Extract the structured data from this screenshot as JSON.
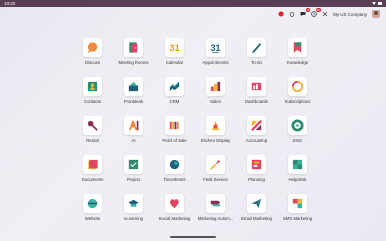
{
  "status": {
    "time": "10:32"
  },
  "topbar": {
    "msg_count": "5",
    "act_count": "99",
    "company": "My US Company"
  },
  "apps": [
    {
      "label": "Discuss",
      "icon": "discuss-icon"
    },
    {
      "label": "Meeting Rooms",
      "icon": "meeting-rooms-icon"
    },
    {
      "label": "Calendar",
      "icon": "calendar-icon",
      "glyph": "31"
    },
    {
      "label": "Appointments",
      "icon": "appointments-icon",
      "glyph": "31"
    },
    {
      "label": "To-do",
      "icon": "todo-icon"
    },
    {
      "label": "Knowledge",
      "icon": "knowledge-icon"
    },
    {
      "label": "Contacts",
      "icon": "contacts-icon"
    },
    {
      "label": "Frontdesk",
      "icon": "frontdesk-icon"
    },
    {
      "label": "CRM",
      "icon": "crm-icon"
    },
    {
      "label": "Sales",
      "icon": "sales-icon"
    },
    {
      "label": "Dashboards",
      "icon": "dashboards-icon"
    },
    {
      "label": "Subscriptions",
      "icon": "subscriptions-icon"
    },
    {
      "label": "Rental",
      "icon": "rental-icon"
    },
    {
      "label": "AI",
      "icon": "ai-icon"
    },
    {
      "label": "Point of Sale",
      "icon": "point-of-sale-icon"
    },
    {
      "label": "Kitchen Display",
      "icon": "kitchen-display-icon"
    },
    {
      "label": "Accounting",
      "icon": "accounting-icon"
    },
    {
      "label": "ESG",
      "icon": "esg-icon"
    },
    {
      "label": "Documents",
      "icon": "documents-icon"
    },
    {
      "label": "Project",
      "icon": "project-icon"
    },
    {
      "label": "Timesheets",
      "icon": "timesheets-icon"
    },
    {
      "label": "Field Service",
      "icon": "field-service-icon"
    },
    {
      "label": "Planning",
      "icon": "planning-icon"
    },
    {
      "label": "Helpdesk",
      "icon": "helpdesk-icon"
    },
    {
      "label": "Website",
      "icon": "website-icon"
    },
    {
      "label": "eLearning",
      "icon": "elearning-icon"
    },
    {
      "label": "Social Marketing",
      "icon": "social-marketing-icon"
    },
    {
      "label": "Marketing Autom...",
      "icon": "marketing-automation-icon"
    },
    {
      "label": "Email Marketing",
      "icon": "email-marketing-icon"
    },
    {
      "label": "SMS Marketing",
      "icon": "sms-marketing-icon"
    }
  ]
}
